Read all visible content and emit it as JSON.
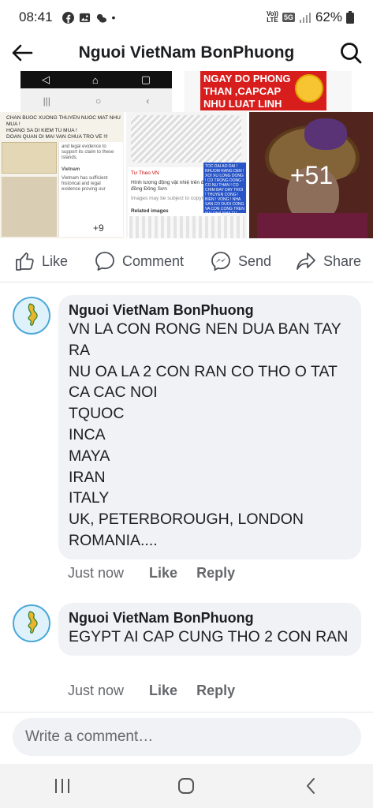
{
  "status_bar": {
    "time": "08:41",
    "network": "5G",
    "volte_line1": "Vo))",
    "volte_line2": "LTE",
    "battery": "62%"
  },
  "header": {
    "title": "Nguoi VietNam BonPhuong",
    "back_icon": "back-arrow-icon",
    "search_icon": "search-icon"
  },
  "media": {
    "banner_text": "Ngay do Phong\nThan ,CAPCAP\nNHU LUAT LINH",
    "tile1_caption": "CHAN BUOC XUONG THUYEN NUOC MAT NHU MUA !\nHOANG SA DI KIEM TU MUA !\nDOAN QUAN DI MAI VAN CHUA TRO VE !!!",
    "tile1_panel_text": "and legal evidence to support its claim to these islands.",
    "tile1_search_label": "Vietnam",
    "tile1_panel_body": "Vietnam has sufficient historical and legal evidence proving our",
    "tile1_more": "+9",
    "tile2_source": "Tư Theo VN",
    "tile2_title": "Hình tượng động vật nhiệ trên đồ đồng Đông Sơn",
    "tile2_note": "Images may be subject to copyright",
    "tile2_related": "Related images",
    "tile2_blue_text": "TOC DAI AO DAI ! NHUOM RANG DEN ! XOI XU LONG DONG ! CO TRONG DONG ! CO NU THAN ! CO CHIM BAY DAY TROI ! THUYEN CONG ! BIEN ! VONG ! NHA SAN CO DUOI CONG VA CON CONG TREN MAI NHA NHA TU TRUONG ! NHAC !",
    "more_count": "+51"
  },
  "actions": {
    "like": "Like",
    "comment": "Comment",
    "send": "Send",
    "share": "Share"
  },
  "comments": [
    {
      "author": "Nguoi VietNam BonPhuong",
      "text": "VN LA CON RONG NEN DUA BAN TAY RA\nNU OA LA 2 CON RAN CO THO O TAT CA CAC NOI\nTQUOC\nINCA\nMAYA\nIRAN\nITALY\nUK, PETERBOROUGH, LONDON\nROMANIA....",
      "time": "Just now",
      "like": "Like",
      "reply": "Reply"
    },
    {
      "author": "Nguoi VietNam BonPhuong",
      "text": "EGYPT AI CAP CUNG THO 2 CON RAN",
      "time": "Just now",
      "like": "Like",
      "reply": "Reply"
    }
  ],
  "composer": {
    "placeholder": "Write a comment…"
  },
  "nav": {
    "recents": "recents-icon",
    "home": "home-icon",
    "back": "back-icon"
  }
}
